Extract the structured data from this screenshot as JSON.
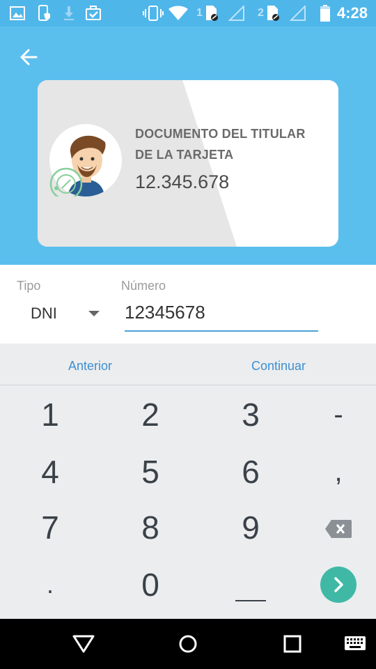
{
  "status_bar": {
    "time": "4:28",
    "sim1": "1",
    "sim2": "2",
    "icons": [
      "gallery-icon",
      "phone-shield-icon",
      "download-icon",
      "briefcase-check-icon",
      "vibrate-icon",
      "wifi-icon",
      "sim1-signal-icon",
      "sim2-signal-icon",
      "battery-icon"
    ]
  },
  "header": {
    "back_icon": "arrow-left-icon",
    "card": {
      "title": "DOCUMENTO DEL TITULAR DE LA TARJETA",
      "number": "12.345.678",
      "avatar": "user-avatar"
    }
  },
  "form": {
    "tipo_label": "Tipo",
    "tipo_value": "DNI",
    "numero_label": "Número",
    "numero_value": "12345678"
  },
  "nav_buttons": {
    "previous": "Anterior",
    "next": "Continuar"
  },
  "keypad": {
    "keys": [
      "1",
      "2",
      "3",
      "-",
      "4",
      "5",
      "6",
      ",",
      "7",
      "8",
      "9",
      "backspace",
      ".",
      "0",
      "_",
      "next"
    ]
  },
  "colors": {
    "header_blue": "#5bbfee",
    "status_blue": "#4fb6ea",
    "link_blue": "#3f8fd0",
    "teal": "#3fb9a6"
  }
}
